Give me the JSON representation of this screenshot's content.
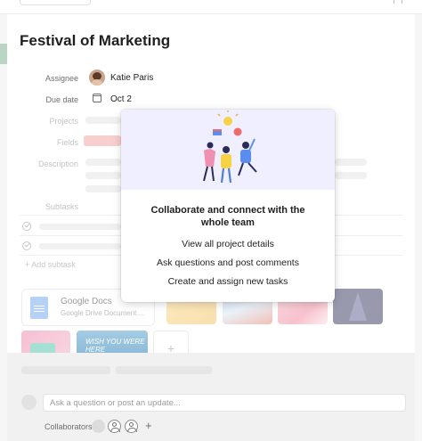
{
  "task": {
    "title": "Festival of Marketing",
    "fields": {
      "assignee_label": "Assignee",
      "assignee_name": "Katie Paris",
      "due_label": "Due date",
      "due_value": "Oct 2",
      "projects_label": "Projects",
      "fields_label": "Fields",
      "description_label": "Description"
    },
    "subtasks_label": "Subtasks",
    "add_subtask_label": "+ Add subtask"
  },
  "attachments": {
    "file": {
      "name": "Google Docs",
      "subtitle": "Google Drive Document ..."
    },
    "image_text": "WISH YOU WERE HERE",
    "add_label": "+"
  },
  "comment": {
    "placeholder": "Ask a question or post an update...",
    "collaborators_label": "Collaborators",
    "add_label": "+"
  },
  "popover": {
    "heading": "Collaborate and connect with the whole team",
    "items": [
      "View all project details",
      "Ask questions and post comments",
      "Create and assign new tasks"
    ]
  },
  "colors": {
    "popover_illustration_bg": "#efefff",
    "fields_tag": "#f7cfcf",
    "left_tab": "#b9d6c4"
  }
}
